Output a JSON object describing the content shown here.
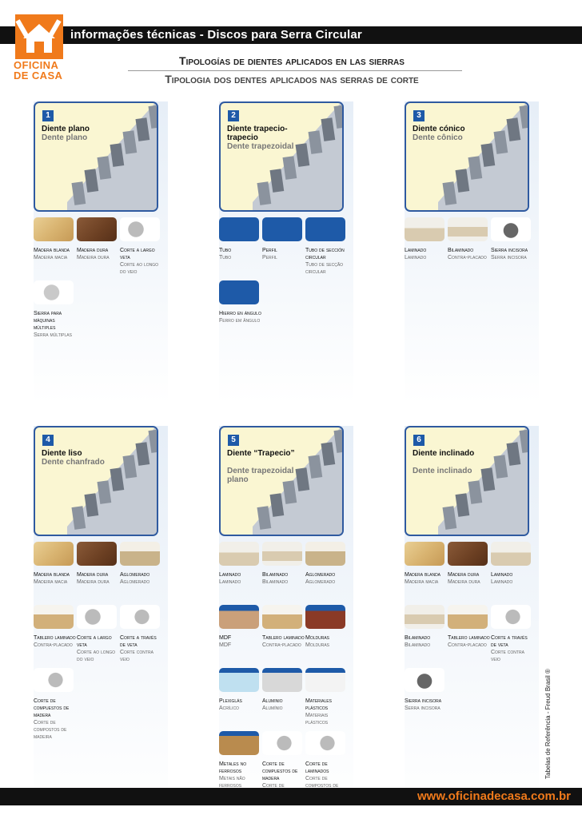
{
  "header": {
    "title": "informações técnicas - Discos para Serra Circular",
    "logo_line1": "OFICINA",
    "logo_line2": "DE CASA"
  },
  "heading": {
    "es": "Tipologías de dientes aplicados en las sierras",
    "pt": "Tipologia dos dentes aplicados nas serras de corte"
  },
  "footer": {
    "url": "www.oficinadecasa.com.br",
    "side_note": "Tabelas de Referência - Freud Brasil ®"
  },
  "colors": {
    "orange": "#f07a1b",
    "blue": "#1e5aa8",
    "dark": "#111111",
    "panel": "#faf6d2"
  },
  "sections": [
    {
      "num": "1",
      "title": "Diente plano",
      "subtitle": "Dente plano",
      "materials": [
        {
          "es": "Madera blanda",
          "pt": "Madeira macia",
          "icon": "softwood"
        },
        {
          "es": "Madera dura",
          "pt": "Madeira dura",
          "icon": "hardwood"
        },
        {
          "es": "Corte a largo veta",
          "pt": "Corte ao longo do veio",
          "icon": "rip-cut"
        },
        {
          "es": "Sierra para máquinas múltiples",
          "pt": "Serra múltiplas",
          "icon": "multi-saw"
        }
      ]
    },
    {
      "num": "2",
      "title": "Diente trapecio-trapecio",
      "subtitle": "Dente trapezoidal",
      "materials": [
        {
          "es": "Tubo",
          "pt": "Tubo",
          "icon": "square-tube"
        },
        {
          "es": "Perfil",
          "pt": "Perfil",
          "icon": "profile"
        },
        {
          "es": "Tubo de sección circular",
          "pt": "Tubo de secção circular",
          "icon": "round-tube"
        },
        {
          "es": "Hierro en ángulo",
          "pt": "Ferro em ângulo",
          "icon": "angle-iron"
        }
      ]
    },
    {
      "num": "3",
      "title": "Diente cónico",
      "subtitle": "Dente cônico",
      "materials": [
        {
          "es": "Laminado",
          "pt": "Laminado",
          "icon": "laminate"
        },
        {
          "es": "Bilaminado",
          "pt": "Contra-placado",
          "icon": "bilaminate"
        },
        {
          "es": "Sierra incisora",
          "pt": "Serra incisora",
          "icon": "scoring-saw"
        }
      ]
    },
    {
      "num": "4",
      "title": "Diente liso",
      "subtitle": "Dente chanfrado",
      "materials": [
        {
          "es": "Madera blanda",
          "pt": "Madeira macia",
          "icon": "softwood"
        },
        {
          "es": "Madera dura",
          "pt": "Madeira dura",
          "icon": "hardwood"
        },
        {
          "es": "Aglomerado",
          "pt": "Aglomerado",
          "icon": "chipboard"
        },
        {
          "es": "Tablero laminado",
          "pt": "Contra-placado",
          "icon": "laminated-board"
        },
        {
          "es": "Corte a largo veta",
          "pt": "Corte ao longo do veio",
          "icon": "rip-cut"
        },
        {
          "es": "Corte a través de veta",
          "pt": "Corte contra veio",
          "icon": "cross-cut"
        },
        {
          "es": "Corte de compuestos de madera",
          "pt": "Corte de compostos de madeira",
          "icon": "composite-cut"
        }
      ]
    },
    {
      "num": "5",
      "title": "Diente “Trapecio”",
      "subtitle": "Dente trapezoidal - plano",
      "materials": [
        {
          "es": "Laminado",
          "pt": "Laminado",
          "icon": "laminate"
        },
        {
          "es": "Bilaminado",
          "pt": "Bilaminado",
          "icon": "bilaminate"
        },
        {
          "es": "Aglomerado",
          "pt": "Aglomerado",
          "icon": "chipboard"
        },
        {
          "es": "MDF",
          "pt": "MDF",
          "icon": "mdf"
        },
        {
          "es": "Tablero laminado",
          "pt": "Contra-placado",
          "icon": "laminated-board"
        },
        {
          "es": "Molduras",
          "pt": "Molduras",
          "icon": "moulding"
        },
        {
          "es": "Plexiglás",
          "pt": "Acrílico",
          "icon": "plexiglass"
        },
        {
          "es": "Aluminio",
          "pt": "Alumínio",
          "icon": "aluminium"
        },
        {
          "es": "Materiales plásticos",
          "pt": "Materiais plásticos",
          "icon": "plastic"
        },
        {
          "es": "Metales no ferrosos",
          "pt": "Metais não ferrosos",
          "icon": "nonferrous"
        },
        {
          "es": "Corte de compuestos de madera",
          "pt": "Corte de compostos de madeira",
          "icon": "composite-cut"
        },
        {
          "es": "Corte de laminados",
          "pt": "Corte de compostos de madeira laminado",
          "icon": "laminate-cut"
        }
      ]
    },
    {
      "num": "6",
      "title": "Diente inclinado",
      "subtitle": "Dente inclinado",
      "materials": [
        {
          "es": "Madera blanda",
          "pt": "Madeira macia",
          "icon": "softwood"
        },
        {
          "es": "Madera dura",
          "pt": "Madeira dura",
          "icon": "hardwood"
        },
        {
          "es": "Laminado",
          "pt": "Laminado",
          "icon": "laminate"
        },
        {
          "es": "Bilaminado",
          "pt": "Bilaminado",
          "icon": "bilaminate"
        },
        {
          "es": "Tablero laminado",
          "pt": "Contra-placado",
          "icon": "laminated-board"
        },
        {
          "es": "Corte a través de veta",
          "pt": "Corte contra veio",
          "icon": "cross-cut"
        },
        {
          "es": "Sierra incisora",
          "pt": "Serra incisora",
          "icon": "scoring-saw"
        }
      ]
    }
  ]
}
